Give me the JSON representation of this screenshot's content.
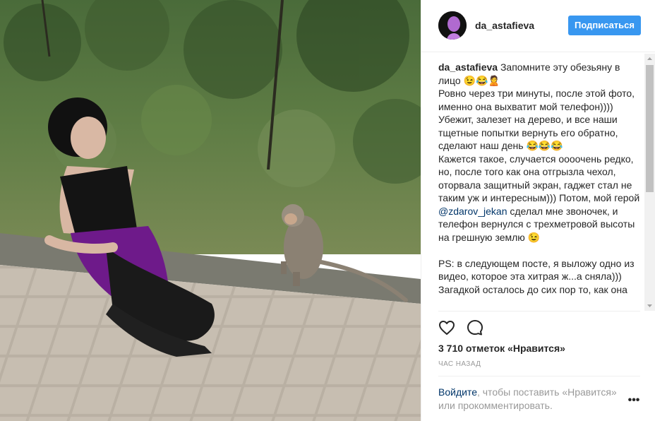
{
  "post": {
    "username": "da_astafieva",
    "follow_label": "Подписаться",
    "caption_user": "da_astafieva",
    "caption_part1": " Запомните эту обезьяну в лицо 😉😂🙎\nРовно через три минуты, после этой фото, именно она выхватит мой телефон))))\nУбежит, залезет на дерево, и все наши тщетные попытки вернуть его обратно, сделают наш день 😂😂😂\nКажется такое, случается оооочень редко, но, после того как она отгрызла чехол, оторвала защитный экран, гаджет стал не таким уж и интересным))) Потом, мой герой ",
    "mention": "@zdarov_jekan",
    "caption_part2": " сделал мне звоночек, и телефон вернулся с трехметровой высоты на грешную землю 😉\n\nPS: в следующем посте, я выложу одно из видео, которое эта хитрая ж...а сняла)))\nЗагадкой осталось до сих пор то, как она",
    "likes": "3 710 отметок «Нравится»",
    "time": "ЧАС НАЗАД",
    "login_link": "Войдите",
    "login_text": ", чтобы поставить «Нравится» или прокомментировать.",
    "more_label": "•••"
  },
  "icons": {
    "like": "heart-icon",
    "comment": "comment-icon",
    "more": "more-options-icon"
  },
  "colors": {
    "follow_button": "#3897f0",
    "link": "#003569",
    "muted": "#999999"
  }
}
